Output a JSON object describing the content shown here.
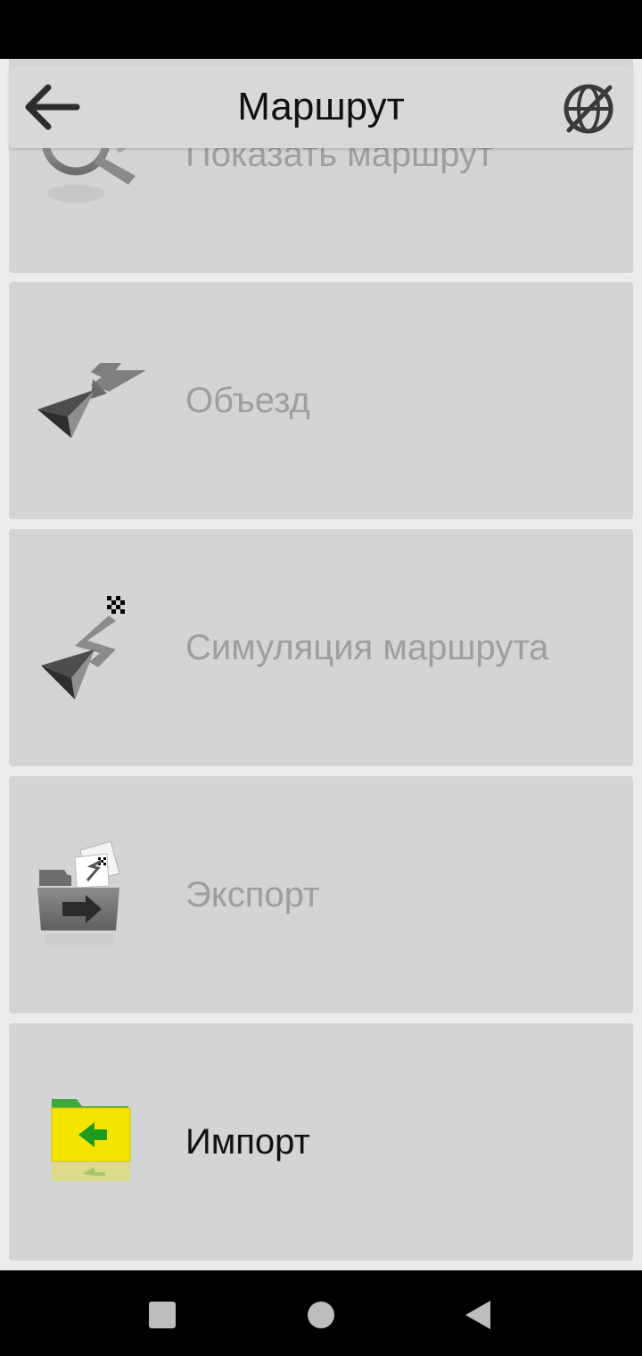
{
  "header": {
    "title": "Маршрут",
    "back_icon": "arrow-left-icon",
    "right_icon": "globe-off-icon"
  },
  "menu": [
    {
      "id": "show-route",
      "label": "Показать маршрут",
      "icon": "route-magnifier-icon",
      "enabled": false
    },
    {
      "id": "detour",
      "label": "Объезд",
      "icon": "detour-arrow-icon",
      "enabled": false
    },
    {
      "id": "simulation",
      "label": "Симуляция маршрута",
      "icon": "route-simulation-icon",
      "enabled": false
    },
    {
      "id": "export",
      "label": "Экспорт",
      "icon": "folder-export-icon",
      "enabled": false
    },
    {
      "id": "import",
      "label": "Импорт",
      "icon": "folder-import-icon",
      "enabled": true
    }
  ],
  "colors": {
    "item_background": "#d3d4d6",
    "disabled_text": "#9d9e9f",
    "enabled_text": "#111111",
    "import_folder": "#f4e400",
    "import_arrow": "#1f9b1f"
  },
  "nav_bar": {
    "icons": [
      "square-icon",
      "circle-icon",
      "triangle-back-icon"
    ]
  }
}
